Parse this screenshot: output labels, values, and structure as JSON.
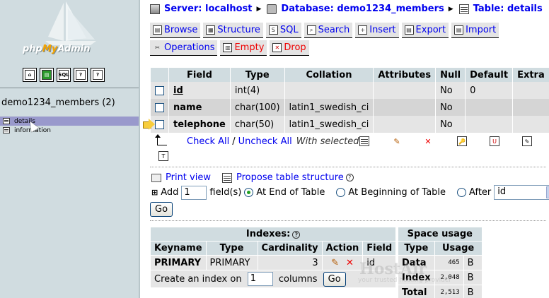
{
  "sidebar": {
    "logo_text_php": "php",
    "logo_text_my": "My",
    "logo_text_admin": "Admin",
    "icons": [
      "home-icon",
      "query-window-icon",
      "sql-icon",
      "docs-icon",
      "docs-sql-icon"
    ],
    "database": "demo1234_members (2)",
    "tables": [
      {
        "label": "details"
      },
      {
        "label": "information"
      }
    ]
  },
  "breadcrumb": {
    "server": "Server: localhost",
    "database": "Database: demo1234_members",
    "table": "Table: details"
  },
  "tabs_row1": [
    {
      "label": "Browse"
    },
    {
      "label": "Structure"
    },
    {
      "label": "SQL"
    },
    {
      "label": "Search"
    },
    {
      "label": "Insert"
    },
    {
      "label": "Export"
    },
    {
      "label": "Import"
    }
  ],
  "tabs_row2": [
    {
      "label": "Operations"
    },
    {
      "label": "Empty"
    },
    {
      "label": "Drop"
    }
  ],
  "structure": {
    "headers": [
      "Field",
      "Type",
      "Collation",
      "Attributes",
      "Null",
      "Default",
      "Extra"
    ],
    "rows": [
      {
        "field": "id",
        "type": "int(4)",
        "collation": "",
        "attributes": "",
        "null": "No",
        "default": "0",
        "extra": ""
      },
      {
        "field": "name",
        "type": "char(100)",
        "collation": "latin1_swedish_ci",
        "attributes": "",
        "null": "No",
        "default": "",
        "extra": ""
      },
      {
        "field": "telephone",
        "type": "char(50)",
        "collation": "latin1_swedish_ci",
        "attributes": "",
        "null": "No",
        "default": "",
        "extra": ""
      }
    ],
    "check_all": "Check All",
    "separator": "/",
    "uncheck_all": "Uncheck All",
    "with_selected": "With selected:"
  },
  "actions": {
    "print_view": "Print view",
    "propose_structure": "Propose table structure",
    "add_label": "Add",
    "add_count": "1",
    "fields_label": "field(s)",
    "at_end": "At End of Table",
    "at_beginning": "At Beginning of Table",
    "after": "After",
    "after_field": "id",
    "go": "Go"
  },
  "indexes": {
    "title": "Indexes:",
    "headers": [
      "Keyname",
      "Type",
      "Cardinality",
      "Action",
      "Field"
    ],
    "row": {
      "keyname": "PRIMARY",
      "type": "PRIMARY",
      "cardinality": "3",
      "field": "id"
    },
    "create_label": "Create an index on",
    "create_count": "1",
    "columns_label": "columns",
    "go": "Go"
  },
  "space_usage": {
    "title": "Space usage",
    "headers": [
      "Type",
      "Usage"
    ],
    "rows": [
      {
        "type": "Data",
        "value": "465",
        "unit": "B"
      },
      {
        "type": "Index",
        "value": "2,048",
        "unit": "B"
      },
      {
        "type": "Total",
        "value": "2,513",
        "unit": "B"
      }
    ]
  },
  "watermark": {
    "brand": "HostAir",
    "tagline": "your trusted hosting provider"
  }
}
